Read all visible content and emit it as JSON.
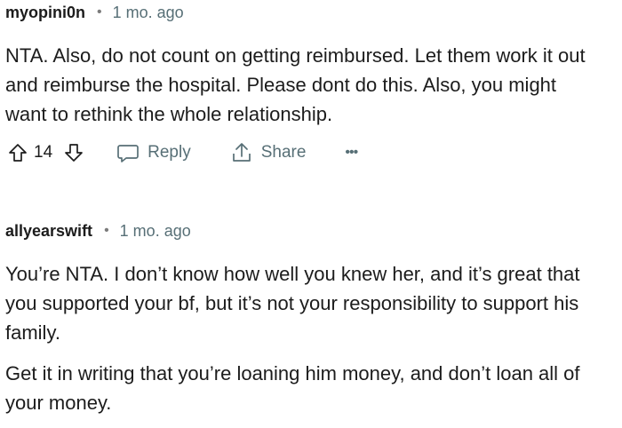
{
  "comments": [
    {
      "username": "myopini0n",
      "separator": "•",
      "time": "1 mo. ago",
      "paragraphs": [
        "NTA. Also, do not count on getting reimbursed. Let them work it out\nand reimburse the hospital. Please dont do this. Also, you might\nwant to rethink the whole relationship."
      ],
      "votes": "14",
      "reply_label": "Reply",
      "share_label": "Share",
      "overflow": "•••"
    },
    {
      "username": "allyearswift",
      "separator": "•",
      "time": "1 mo. ago",
      "paragraphs": [
        "You’re NTA. I don’t know how well you knew her, and it’s great that\nyou supported your bf, but it’s not your responsibility to support his\nfamily.",
        "Get it in writing that you’re loaning him money, and don’t loan all of\nyour money."
      ]
    }
  ]
}
